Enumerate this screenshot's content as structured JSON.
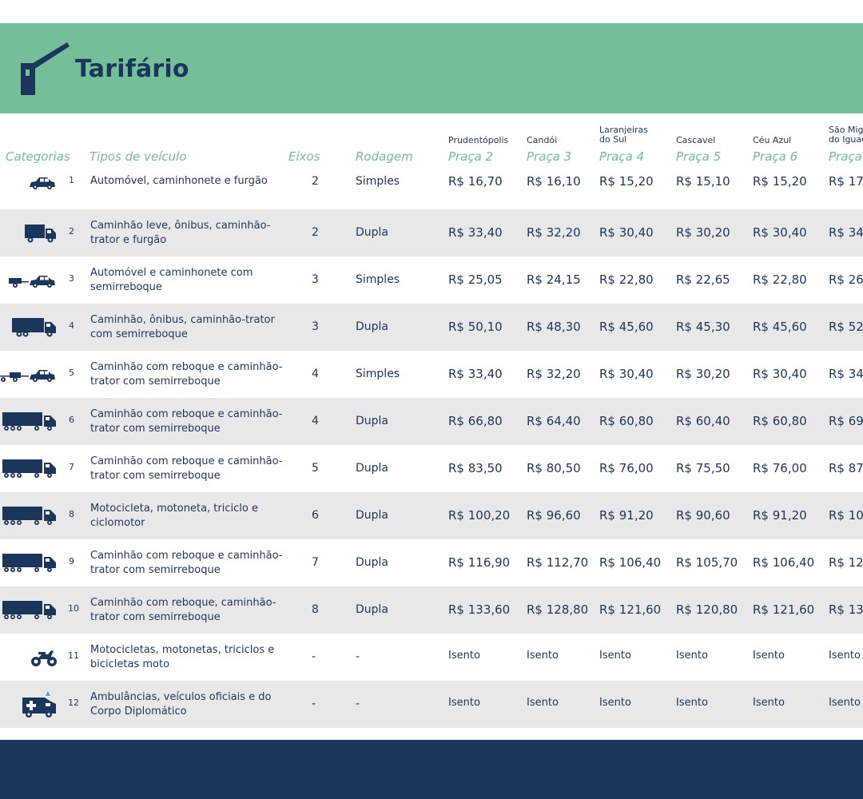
{
  "header": {
    "title": "Tarifário"
  },
  "columns": {
    "categorias": "Categorias",
    "tipos": "Tipos de veículo",
    "eixos": "Eixos",
    "rodagem": "Rodagem",
    "plazas": [
      {
        "name_line1": "Prudentópolis",
        "name_line2": "",
        "label": "Praça 2"
      },
      {
        "name_line1": "Candói",
        "name_line2": "",
        "label": "Praça 3"
      },
      {
        "name_line1": "Laranjeiras",
        "name_line2": "do Sul",
        "label": "Praça 4"
      },
      {
        "name_line1": "Cascavel",
        "name_line2": "",
        "label": "Praça 5"
      },
      {
        "name_line1": "Céu Azul",
        "name_line2": "",
        "label": "Praça 6"
      },
      {
        "name_line1": "São Mig",
        "name_line2": "do Iguaç",
        "label": "Praça"
      }
    ]
  },
  "rows": [
    {
      "cat": "1",
      "icon": "car-icon",
      "desc": "Automóvel, caminhonete e furgão",
      "eixos": "2",
      "rodagem": "Simples",
      "prices": [
        "R$ 16,70",
        "R$ 16,10",
        "R$ 15,20",
        "R$ 15,10",
        "R$ 15,20",
        "R$ 17"
      ]
    },
    {
      "cat": "2",
      "icon": "small-truck-icon",
      "desc": "Caminhão leve, ônibus, caminhão-trator e furgão",
      "eixos": "2",
      "rodagem": "Dupla",
      "prices": [
        "R$ 33,40",
        "R$ 32,20",
        "R$ 30,40",
        "R$ 30,20",
        "R$ 30,40",
        "R$ 34"
      ]
    },
    {
      "cat": "3",
      "icon": "car-trailer-icon",
      "desc": "Automóvel e caminhonete com semirreboque",
      "eixos": "3",
      "rodagem": "Simples",
      "prices": [
        "R$ 25,05",
        "R$ 24,15",
        "R$ 22,80",
        "R$ 22,65",
        "R$ 22,80",
        "R$ 26"
      ]
    },
    {
      "cat": "4",
      "icon": "truck-icon",
      "desc": "Caminhão, ônibus, caminhão-trator com semirreboque",
      "eixos": "3",
      "rodagem": "Dupla",
      "prices": [
        "R$ 50,10",
        "R$ 48,30",
        "R$ 45,60",
        "R$ 45,30",
        "R$ 45,60",
        "R$ 52"
      ]
    },
    {
      "cat": "5",
      "icon": "car-two-trailers-icon",
      "desc": "Caminhão com reboque e caminhão-trator com semirreboque",
      "eixos": "4",
      "rodagem": "Simples",
      "prices": [
        "R$ 33,40",
        "R$ 32,20",
        "R$ 30,40",
        "R$ 30,20",
        "R$ 30,40",
        "R$ 34"
      ]
    },
    {
      "cat": "6",
      "icon": "semi-truck-icon",
      "desc": "Caminhão com reboque e caminhão-trator com semirreboque",
      "eixos": "4",
      "rodagem": "Dupla",
      "prices": [
        "R$ 66,80",
        "R$ 64,40",
        "R$ 60,80",
        "R$ 60,40",
        "R$ 60,80",
        "R$ 69"
      ]
    },
    {
      "cat": "7",
      "icon": "semi-truck-icon",
      "desc": "Caminhão com reboque e caminhão-trator com semirreboque",
      "eixos": "5",
      "rodagem": "Dupla",
      "prices": [
        "R$ 83,50",
        "R$ 80,50",
        "R$ 76,00",
        "R$ 75,50",
        "R$ 76,00",
        "R$ 87"
      ]
    },
    {
      "cat": "8",
      "icon": "semi-truck-icon",
      "desc": "Motocicleta, motoneta, triciclo e ciclomotor",
      "eixos": "6",
      "rodagem": "Dupla",
      "prices": [
        "R$ 100,20",
        "R$ 96,60",
        "R$ 91,20",
        "R$ 90,60",
        "R$ 91,20",
        "R$ 10"
      ]
    },
    {
      "cat": "9",
      "icon": "semi-truck-icon",
      "desc": "Caminhão com reboque e caminhão-trator com semirreboque",
      "eixos": "7",
      "rodagem": "Dupla",
      "prices": [
        "R$ 116,90",
        "R$ 112,70",
        "R$ 106,40",
        "R$ 105,70",
        "R$ 106,40",
        "R$ 12"
      ]
    },
    {
      "cat": "10",
      "icon": "semi-truck-icon",
      "desc": "Caminhão com reboque, caminhão-trator com semirreboque",
      "eixos": "8",
      "rodagem": "Dupla",
      "prices": [
        "R$ 133,60",
        "R$ 128,80",
        "R$ 121,60",
        "R$ 120,80",
        "R$ 121,60",
        "R$ 13"
      ]
    },
    {
      "cat": "11",
      "icon": "motorcycle-icon",
      "desc": "Motocicletas, motonetas, triciclos e bicicletas moto",
      "eixos": "-",
      "rodagem": "-",
      "prices": [
        "Isento",
        "Isento",
        "Isento",
        "Isento",
        "Isento",
        "Isento"
      ]
    },
    {
      "cat": "12",
      "icon": "ambulance-icon",
      "desc": "Ambulâncias, veículos oficiais e do Corpo Diplomático",
      "eixos": "-",
      "rodagem": "-",
      "prices": [
        "Isento",
        "Isento",
        "Isento",
        "Isento",
        "Isento",
        "Isento"
      ]
    }
  ]
}
